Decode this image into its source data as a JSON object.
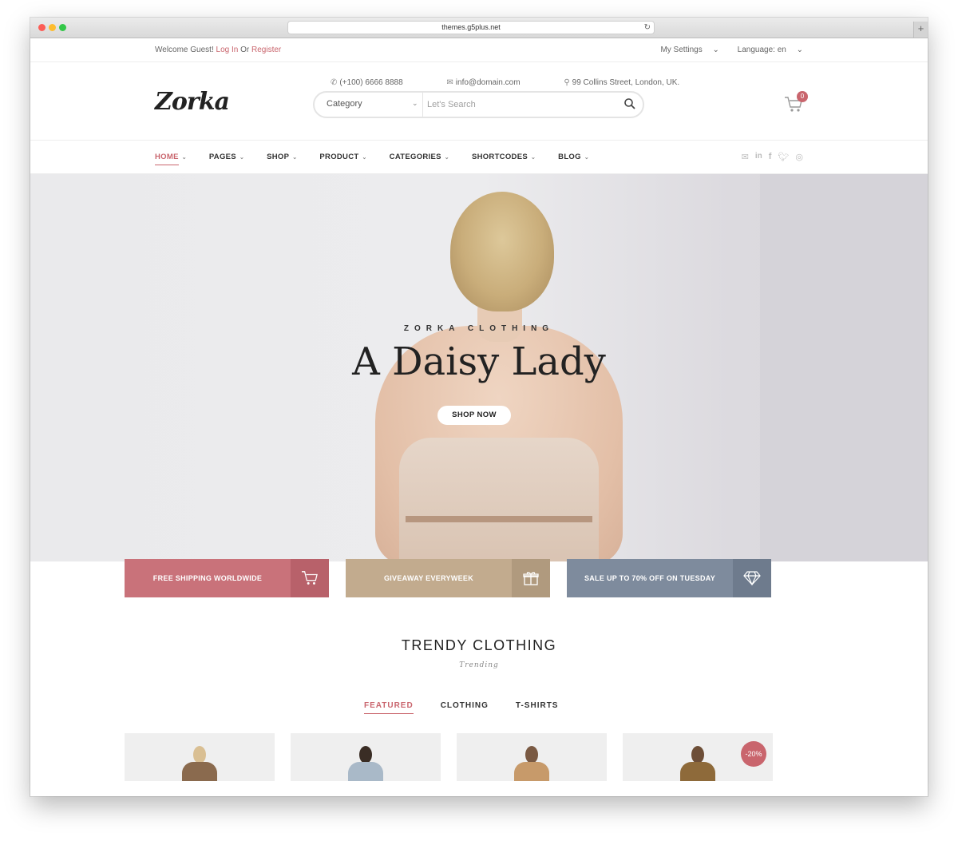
{
  "browser": {
    "url": "themes.g5plus.net"
  },
  "topbar": {
    "welcome": "Welcome Guest!",
    "login": "Log In",
    "or": "Or",
    "register": "Register",
    "settings": "My Settings",
    "language": "Language: en"
  },
  "header": {
    "logo": "Zorka",
    "phone": "(+100) 6666 8888",
    "email": "info@domain.com",
    "address": "99 Collins Street, London, UK.",
    "search_category": "Category",
    "search_placeholder": "Let's Search",
    "cart_count": "0"
  },
  "nav": {
    "items": [
      {
        "label": "HOME"
      },
      {
        "label": "PAGES"
      },
      {
        "label": "SHOP"
      },
      {
        "label": "PRODUCT"
      },
      {
        "label": "CATEGORIES"
      },
      {
        "label": "SHORTCODES"
      },
      {
        "label": "BLOG"
      }
    ],
    "social_icons": [
      "envelope-icon",
      "linkedin-icon",
      "facebook-icon",
      "twitter-icon",
      "dribbble-icon"
    ]
  },
  "hero": {
    "subtitle": "ZORKA CLOTHING",
    "title": "A Daisy Lady",
    "button": "SHOP NOW"
  },
  "promos": [
    {
      "label": "FREE SHIPPING WORLDWIDE",
      "icon": "cart-icon",
      "color": "#c9727a"
    },
    {
      "label": "GIVEAWAY EVERYWEEK",
      "icon": "gift-icon",
      "color": "#c2ab8e"
    },
    {
      "label": "SALE UP TO 70% OFF ON TUESDAY",
      "icon": "diamond-icon",
      "color": "#7e8b9d"
    }
  ],
  "trending": {
    "title": "TRENDY CLOTHING",
    "subtitle": "Trending",
    "tabs": [
      {
        "label": "FEATURED"
      },
      {
        "label": "CLOTHING"
      },
      {
        "label": "T-SHIRTS"
      }
    ],
    "sale_badge": "-20%"
  },
  "colors": {
    "accent": "#c9656d"
  }
}
